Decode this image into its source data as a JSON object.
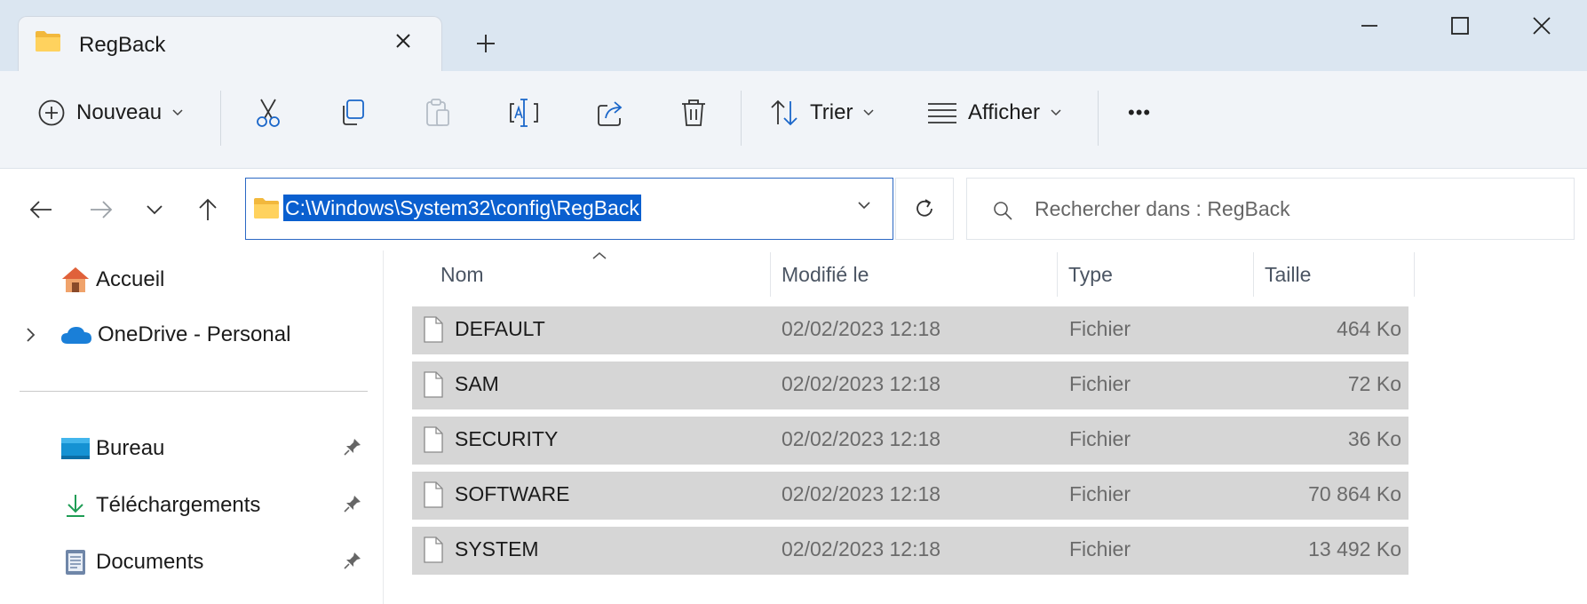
{
  "window": {
    "tab_title": "RegBack",
    "new_tab_symbol": "+",
    "close_tab_symbol": "✕"
  },
  "toolbar": {
    "new_label": "Nouveau",
    "sort_label": "Trier",
    "view_label": "Afficher",
    "more_label": "•••"
  },
  "address": {
    "path": "C:\\Windows\\System32\\config\\RegBack"
  },
  "search": {
    "placeholder": "Rechercher dans : RegBack"
  },
  "sidebar": {
    "items": [
      {
        "label": "Accueil",
        "icon": "home-icon"
      },
      {
        "label": "OneDrive - Personal",
        "icon": "cloud-icon"
      },
      {
        "label": "Bureau",
        "icon": "desktop-icon",
        "pinned": true
      },
      {
        "label": "Téléchargements",
        "icon": "download-icon",
        "pinned": true
      },
      {
        "label": "Documents",
        "icon": "documents-icon",
        "pinned": true
      }
    ]
  },
  "columns": [
    "Nom",
    "Modifié le",
    "Type",
    "Taille"
  ],
  "files": [
    {
      "name": "DEFAULT",
      "modified": "02/02/2023 12:18",
      "type": "Fichier",
      "size": "464 Ko"
    },
    {
      "name": "SAM",
      "modified": "02/02/2023 12:18",
      "type": "Fichier",
      "size": "72 Ko"
    },
    {
      "name": "SECURITY",
      "modified": "02/02/2023 12:18",
      "type": "Fichier",
      "size": "36 Ko"
    },
    {
      "name": "SOFTWARE",
      "modified": "02/02/2023 12:18",
      "type": "Fichier",
      "size": "70 864 Ko"
    },
    {
      "name": "SYSTEM",
      "modified": "02/02/2023 12:18",
      "type": "Fichier",
      "size": "13 492 Ko"
    }
  ],
  "colors": {
    "accent": "#0a5fcf",
    "titlebar": "#dbe6f1",
    "toolbar": "#f1f4f8",
    "row_selected": "#d6d6d6"
  }
}
